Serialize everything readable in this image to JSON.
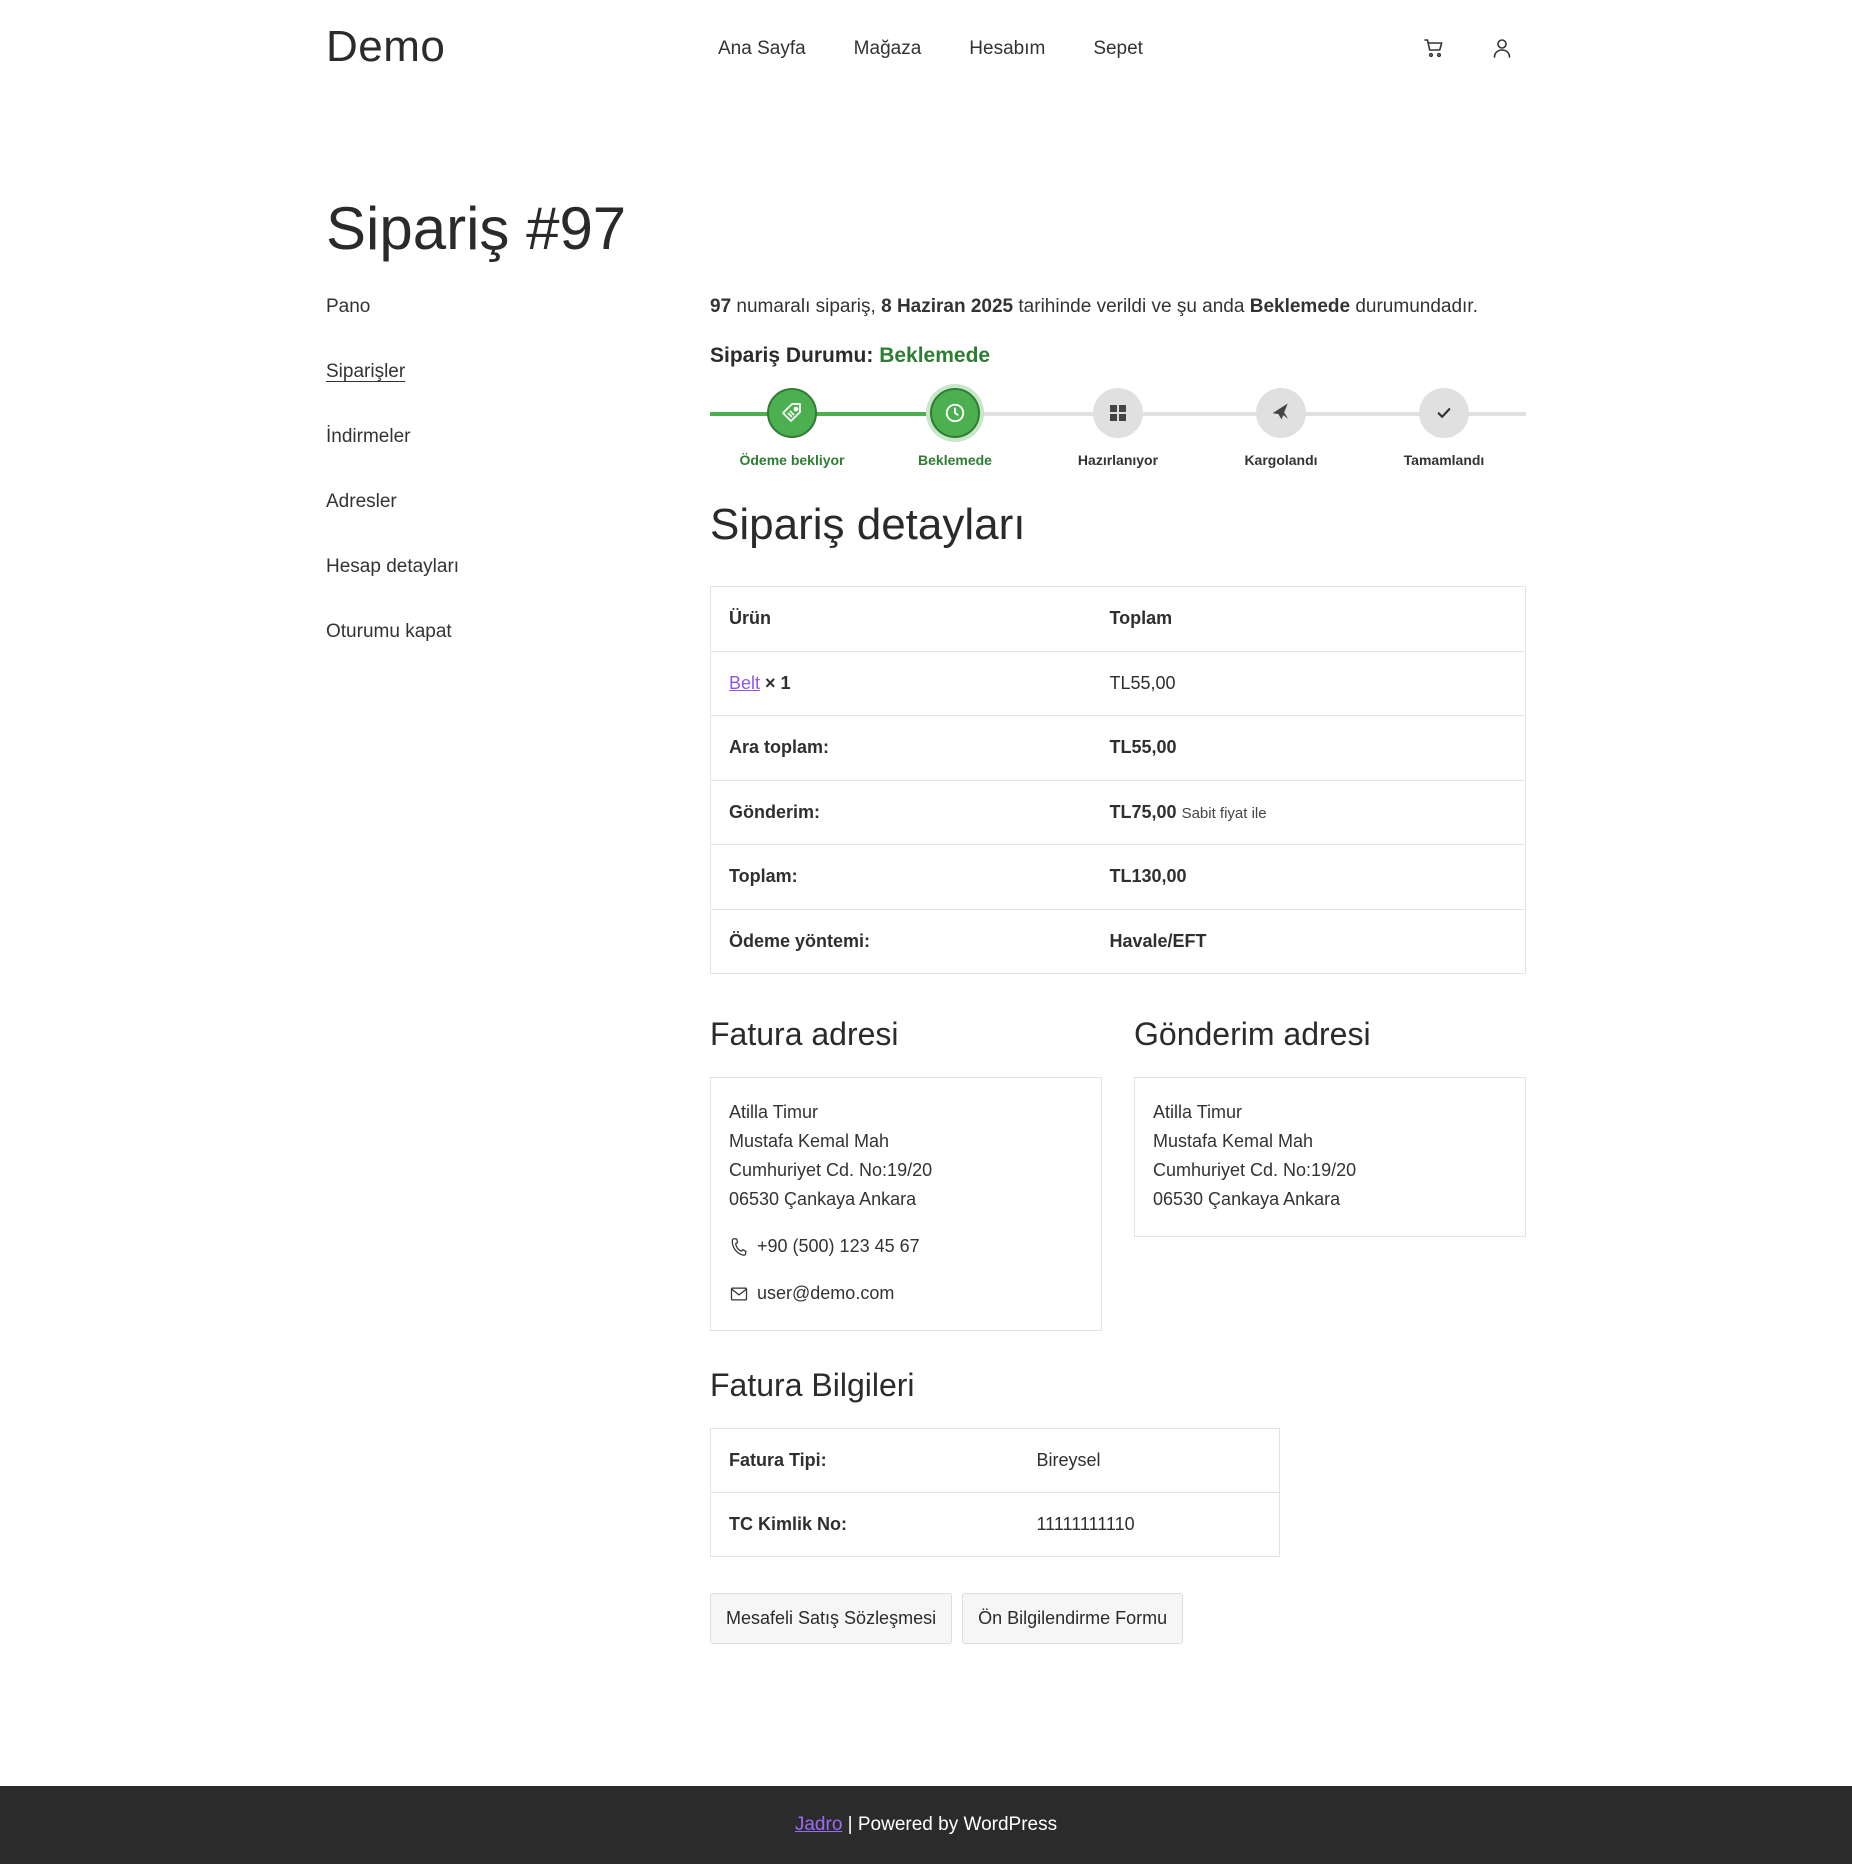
{
  "site": {
    "title": "Demo"
  },
  "nav": {
    "items": [
      {
        "label": "Ana Sayfa"
      },
      {
        "label": "Mağaza"
      },
      {
        "label": "Hesabım"
      },
      {
        "label": "Sepet"
      }
    ]
  },
  "icons": {
    "cart": "cart-icon",
    "account": "user-icon"
  },
  "page": {
    "title": "Sipariş #97"
  },
  "sidebar": {
    "items": [
      {
        "label": "Pano"
      },
      {
        "label": "Siparişler"
      },
      {
        "label": "İndirmeler"
      },
      {
        "label": "Adresler"
      },
      {
        "label": "Hesap detayları"
      },
      {
        "label": "Oturumu kapat"
      }
    ]
  },
  "intro": {
    "order_no": "97",
    "t1": "numaralı sipariş,",
    "date": "8 Haziran 2025",
    "t2": "tarihinde verildi ve şu anda",
    "status": "Beklemede",
    "t3": "durumundadır."
  },
  "status": {
    "label": "Sipariş Durumu:",
    "value": "Beklemede",
    "color": "#2e7d32"
  },
  "tracker": {
    "steps": [
      {
        "label": "Ödeme bekliyor",
        "state": "complete",
        "icon": "tag-icon"
      },
      {
        "label": "Beklemede",
        "state": "current",
        "icon": "clock-icon"
      },
      {
        "label": "Hazırlanıyor",
        "state": "pending",
        "icon": "grid-icon"
      },
      {
        "label": "Kargolandı",
        "state": "pending",
        "icon": "plane-icon"
      },
      {
        "label": "Tamamlandı",
        "state": "pending",
        "icon": "check-icon"
      }
    ]
  },
  "details": {
    "title": "Sipariş detayları",
    "col_product": "Ürün",
    "col_total": "Toplam",
    "product_name": "Belt",
    "product_qty": "× 1",
    "product_total": "TL55,00",
    "subtotal_label": "Ara toplam:",
    "subtotal_value": "TL55,00",
    "shipping_label": "Gönderim:",
    "shipping_value": "TL75,00",
    "shipping_method": "Sabit fiyat ile",
    "total_label": "Toplam:",
    "total_value": "TL130,00",
    "payment_label": "Ödeme yöntemi:",
    "payment_value": "Havale/EFT"
  },
  "billing": {
    "title": "Fatura adresi",
    "name": "Atilla Timur",
    "line1": "Mustafa Kemal Mah",
    "line2": "Cumhuriyet Cd. No:19/20",
    "line3": "06530 Çankaya Ankara",
    "phone": "+90 (500) 123 45 67",
    "email": "user@demo.com"
  },
  "shipping": {
    "title": "Gönderim adresi",
    "name": "Atilla Timur",
    "line1": "Mustafa Kemal Mah",
    "line2": "Cumhuriyet Cd. No:19/20",
    "line3": "06530 Çankaya Ankara"
  },
  "invoice": {
    "title": "Fatura Bilgileri",
    "type_label": "Fatura Tipi:",
    "type_value": "Bireysel",
    "tc_label": "TC Kimlik No:",
    "tc_value": "11111111110"
  },
  "actions": {
    "contract": "Mesafeli Satış Sözleşmesi",
    "preinfo": "Ön Bilgilendirme Formu"
  },
  "footer": {
    "link": "Jadro",
    "text": "| Powered by WordPress"
  },
  "colors": {
    "accent_green": "#4caf50",
    "link_purple": "#8e57e8",
    "footer_bg": "#2b2b2b"
  }
}
